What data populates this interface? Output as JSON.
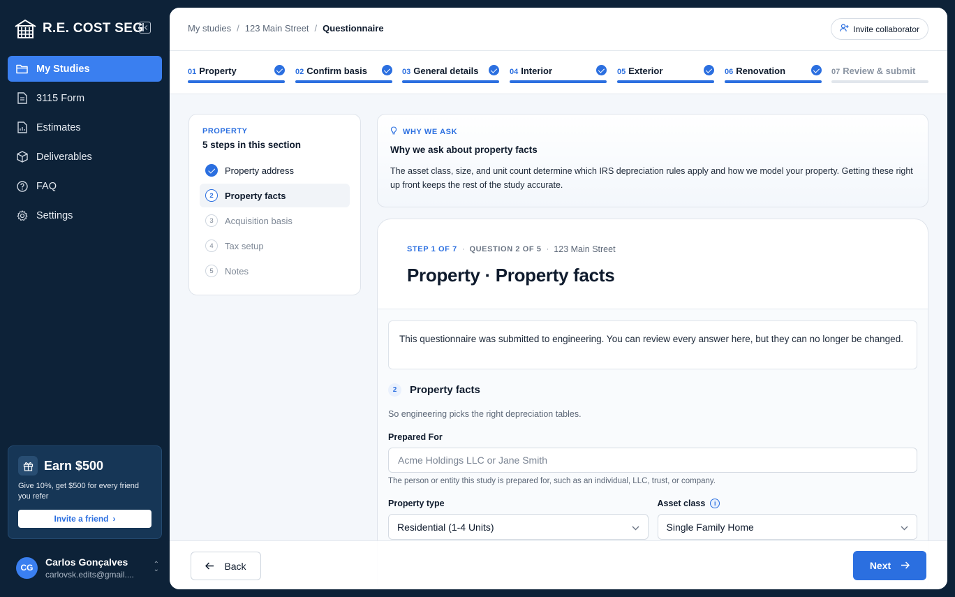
{
  "app": {
    "name": "R.E. COST SEG"
  },
  "sidebar": {
    "items": [
      {
        "label": "My Studies",
        "icon": "folder-icon",
        "active": true
      },
      {
        "label": "3115 Form",
        "icon": "document-icon"
      },
      {
        "label": "Estimates",
        "icon": "calculator-doc-icon"
      },
      {
        "label": "Deliverables",
        "icon": "package-icon"
      },
      {
        "label": "FAQ",
        "icon": "question-circle-icon"
      },
      {
        "label": "Settings",
        "icon": "gear-icon"
      }
    ],
    "earn": {
      "title": "Earn $500",
      "description": "Give 10%, get $500 for every friend you refer",
      "button": "Invite a friend"
    },
    "user": {
      "initials": "CG",
      "name": "Carlos Gonçalves",
      "email": "carlovsk.edits@gmail...."
    }
  },
  "header": {
    "breadcrumbs": [
      "My studies",
      "123 Main Street",
      "Questionnaire"
    ],
    "invite_label": "Invite collaborator"
  },
  "steps": [
    {
      "num": "01",
      "label": "Property",
      "done": true
    },
    {
      "num": "02",
      "label": "Confirm basis",
      "done": true
    },
    {
      "num": "03",
      "label": "General details",
      "done": true
    },
    {
      "num": "04",
      "label": "Interior",
      "done": true
    },
    {
      "num": "05",
      "label": "Exterior",
      "done": true
    },
    {
      "num": "06",
      "label": "Renovation",
      "done": true
    },
    {
      "num": "07",
      "label": "Review & submit",
      "done": false
    }
  ],
  "section": {
    "kicker": "PROPERTY",
    "title": "5 steps in this section",
    "items": [
      {
        "n": "1",
        "label": "Property address",
        "state": "done"
      },
      {
        "n": "2",
        "label": "Property facts",
        "state": "active"
      },
      {
        "n": "3",
        "label": "Acquisition basis",
        "state": "pending"
      },
      {
        "n": "4",
        "label": "Tax setup",
        "state": "pending"
      },
      {
        "n": "5",
        "label": "Notes",
        "state": "pending"
      }
    ]
  },
  "why": {
    "kicker": "WHY WE ASK",
    "title": "Why we ask about property facts",
    "body": "The asset class, size, and unit count determine which IRS depreciation rules apply and how we model your property. Getting these right up front keeps the rest of the study accurate."
  },
  "question": {
    "step": "STEP 1 OF 7",
    "qnum": "QUESTION 2 OF 5",
    "address": "123 Main Street",
    "title": "Property · Property facts",
    "notice": "This questionnaire was submitted to engineering. You can review every answer here, but they can no longer be changed.",
    "section_num": "2",
    "section_title": "Property facts",
    "section_desc": "So engineering picks the right depreciation tables.",
    "prepared_for_label": "Prepared For",
    "prepared_for_placeholder": "Acme Holdings LLC or Jane Smith",
    "prepared_for_help": "The person or entity this study is prepared for, such as an individual, LLC, trust, or company.",
    "property_type_label": "Property type",
    "property_type_value": "Residential (1-4 Units)",
    "asset_class_label": "Asset class",
    "asset_class_value": "Single Family Home"
  },
  "footer": {
    "back": "Back",
    "next": "Next"
  },
  "colors": {
    "accent": "#2b6fe0",
    "sidebar_bg": "#0d2238"
  }
}
